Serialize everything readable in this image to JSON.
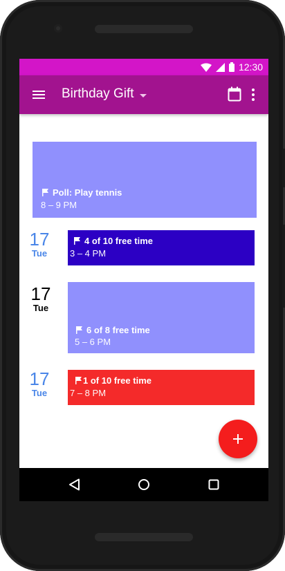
{
  "status_bar": {
    "time": "12:30",
    "icons": [
      "wifi-icon",
      "signal-icon",
      "battery-icon"
    ]
  },
  "app_bar": {
    "title": "Birthday Gift",
    "menu_icon": "menu-icon",
    "calendar_icon": "calendar-icon",
    "more_icon": "more-vert-icon"
  },
  "events": [
    {
      "title": "Poll: Play tennis",
      "time": "8 – 9 PM",
      "color": "#9090fd",
      "icon": "flag-icon"
    },
    {
      "title": "4 of 10 free time",
      "time": "3 – 4 PM",
      "color": "#2c00c4",
      "icon": "flag-icon"
    },
    {
      "title": "6 of 8 free time",
      "time": "5 – 6 PM",
      "color": "#9090fd",
      "icon": "flag-icon"
    },
    {
      "title": "1 of 10 free time",
      "time": "7 – 8 PM",
      "color": "#f42a2a",
      "icon": "flag-icon"
    }
  ],
  "dates": [
    {
      "day": "17",
      "weekday": "Tue",
      "color": "#4a86e8"
    },
    {
      "day": "17",
      "weekday": "Tue",
      "color": "#000000"
    },
    {
      "day": "17",
      "weekday": "Tue",
      "color": "#4a86e8"
    }
  ],
  "fab": {
    "icon": "plus-icon",
    "color": "#f41d1d"
  },
  "nav_bar": {
    "icons": [
      "back-icon",
      "home-icon",
      "recents-icon"
    ]
  },
  "colors": {
    "status_bar": "#d315c8",
    "app_bar": "#a2138f"
  }
}
